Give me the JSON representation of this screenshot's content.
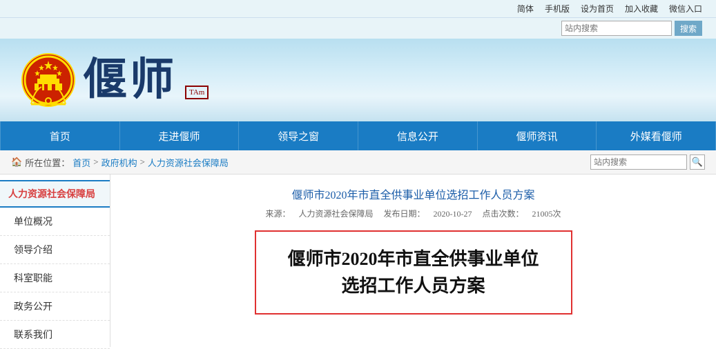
{
  "top_links": [
    "简体",
    "手机版",
    "设为首页",
    "加入收藏",
    "微信入口"
  ],
  "search_placeholder": "站内搜索",
  "search_button": "搜索",
  "header": {
    "logo_text": "偃师",
    "logo_seal": "TAm"
  },
  "nav": {
    "items": [
      "首页",
      "走进偃师",
      "领导之窗",
      "信息公开",
      "偃师资讯",
      "外媒看偃师"
    ]
  },
  "breadcrumb": {
    "home": "首页",
    "items": [
      "政府机构",
      "人力资源社会保障局"
    ],
    "separator": "►",
    "search_placeholder": "站内搜索",
    "location_prefix": "所在位置："
  },
  "sidebar": {
    "title": "人力资源社会保障局",
    "items": [
      "单位概况",
      "领导介绍",
      "科室职能",
      "政务公开",
      "联系我们"
    ]
  },
  "article": {
    "title": "偃师市2020年市直全供事业单位选招工作人员方案",
    "meta": {
      "source_label": "来源：",
      "source": "人力资源社会保障局",
      "date_label": "发布日期：",
      "date": "2020-10-27",
      "views_label": "点击次数：",
      "views": "21005次"
    },
    "highlight_line1": "偃师市2020年市直全供事业单位",
    "highlight_line2": "选招工作人员方案"
  }
}
